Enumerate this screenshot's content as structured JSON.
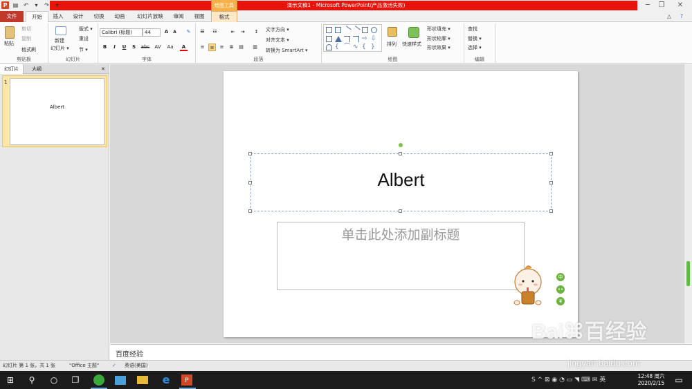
{
  "window": {
    "title": "演示文稿1 - Microsoft PowerPoint(产品激活失败)",
    "context_tab_group": "绘图工具",
    "min": "─",
    "restore": "❐",
    "close": "✕"
  },
  "qat": {
    "app": "P",
    "save": "▤",
    "undo": "↶",
    "undo_arrow": "▾",
    "redo": "↷",
    "customize": "▾"
  },
  "tabs": [
    "文件",
    "开始",
    "插入",
    "设计",
    "切换",
    "动画",
    "幻灯片放映",
    "审阅",
    "视图",
    "格式"
  ],
  "ribbon_right": {
    "minimize": "△",
    "help": "?"
  },
  "ribbon": {
    "clipboard": {
      "label": "剪贴板",
      "paste": "粘贴",
      "cut": "剪切",
      "copy": "复制",
      "format_painter": "格式刷"
    },
    "slides": {
      "label": "幻灯片",
      "new_slide": "新建",
      "new_slide2": "幻灯片 ▾",
      "layout": "版式 ▾",
      "reset": "重设",
      "section": "节 ▾"
    },
    "font": {
      "label": "字体",
      "font_name": "Calibri (标题)",
      "font_size": "44",
      "grow": "A",
      "shrink": "A",
      "clear": "✎",
      "bold": "B",
      "italic": "I",
      "underline": "U",
      "shadow": "S",
      "strike": "abc",
      "spacing": "AV",
      "case": "Aa",
      "color": "A"
    },
    "paragraph": {
      "label": "段落",
      "text_direction": "文字方向 ▾",
      "align_text": "对齐文本 ▾",
      "smartart": "转换为 SmartArt ▾"
    },
    "drawing": {
      "label": "绘图",
      "arrange": "排列",
      "quick_styles": "快速样式",
      "fill": "形状填充 ▾",
      "outline": "形状轮廓 ▾",
      "effects": "形状效果 ▾"
    },
    "editing": {
      "label": "编辑",
      "find": "查找",
      "replace": "替换 ▾",
      "select": "选择 ▾"
    }
  },
  "pane": {
    "tab_slides": "幻灯片",
    "tab_outline": "大纲",
    "close": "✕",
    "slide_number": "1",
    "thumb_text": "Albert"
  },
  "slide": {
    "title": "Albert",
    "subtitle_placeholder": "单击此处添加副标题"
  },
  "side_buttons": {
    "b1": "中",
    "b2": "••",
    "b3": "❦"
  },
  "notes": {
    "text": "百度经验"
  },
  "status": {
    "slide_info": "幻灯片 第 1 张，共 1 张",
    "theme": "\"Office 主题\"",
    "spell": "✓",
    "language": "英语(美国)"
  },
  "watermark": {
    "brand": "Bai⌘百经验",
    "url": "jingyan.baidu.com"
  },
  "taskbar": {
    "start": "⊞",
    "search": "⚲",
    "cortana": "○",
    "taskview": "❐",
    "clock_time": "12:48 周六",
    "clock_date": "2020/2/15",
    "notify": "▭",
    "tray_icons": "S  ^ ⊠ ◉ ◔ ▭ ◥ ⌨ ✉ 英"
  }
}
